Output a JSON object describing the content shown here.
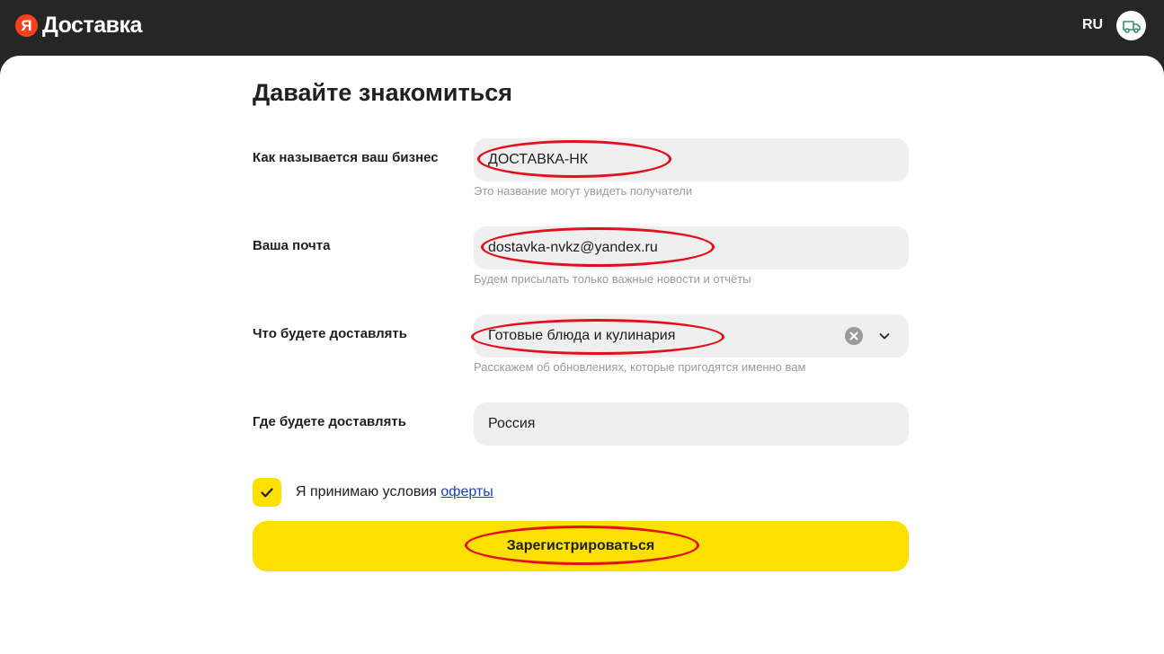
{
  "header": {
    "logo_letter": "Я",
    "logo_text": "Доставка",
    "language": "RU",
    "avatar_icon": "delivery-truck-icon"
  },
  "form": {
    "title": "Давайте знакомиться",
    "business_name": {
      "label": "Как называется ваш бизнес",
      "value": "ДОСТАВКА-НК",
      "hint": "Это название могут увидеть получатели"
    },
    "email": {
      "label": "Ваша почта",
      "value": "dostavka-nvkz@yandex.ru",
      "hint": "Будем присылать только важные новости и отчёты"
    },
    "category": {
      "label": "Что будете доставлять",
      "value": "Готовые блюда и кулинария",
      "hint": "Расскажем об обновлениях, которые пригодятся именно вам"
    },
    "country": {
      "label": "Где будете доставлять",
      "value": "Россия"
    },
    "consent": {
      "checked": true,
      "text": "Я принимаю условия ",
      "link_text": "оферты"
    },
    "submit_label": "Зарегистрироваться"
  },
  "colors": {
    "header_bg": "#262626",
    "accent_yellow": "#fce000",
    "logo_red": "#fc3f1d",
    "annotation_red": "#e3101e",
    "link_blue": "#1a3ecb"
  }
}
